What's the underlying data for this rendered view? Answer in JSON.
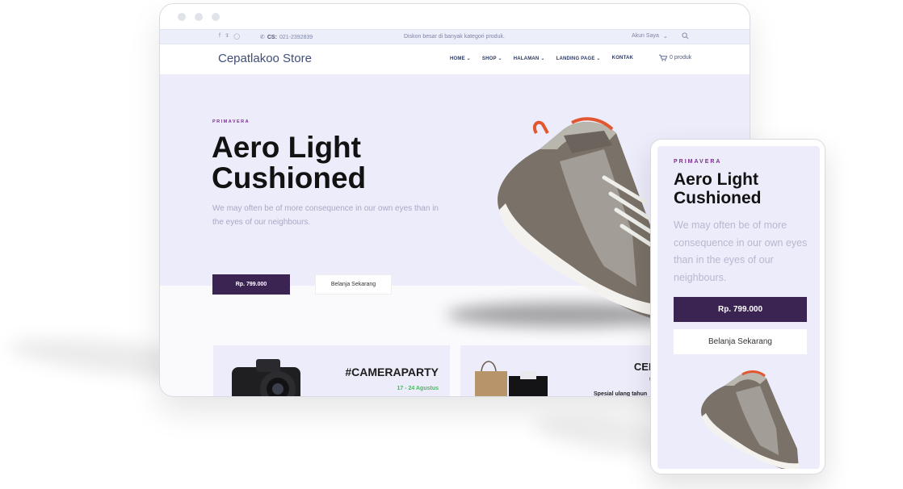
{
  "topbar": {
    "social_icons": [
      "facebook-icon",
      "twitter-icon",
      "instagram-icon"
    ],
    "cs_label": "CS:",
    "cs_phone": "021-2392839",
    "promo_text": "Diskon besar di banyak kategori produk.",
    "account_label": "Akun Saya"
  },
  "nav": {
    "brand": "Cepatlakoo Store",
    "menu": [
      "HOME",
      "SHOP",
      "HALAMAN",
      "LANDING PAGE",
      "KONTAK"
    ],
    "cart_label": "0 produk"
  },
  "hero": {
    "eyebrow": "PRIMAVERA",
    "title": "Aero Light Cushioned",
    "description": "We may often be of more consequence in our own eyes than in the eyes of our neighbours.",
    "price_button": "Rp. 799.000",
    "shop_button": "Belanja Sekarang"
  },
  "promos": [
    {
      "title": "#CAMERAPARTY",
      "subtitle": "17 - 24 Agustus"
    },
    {
      "title": "CEPATL GIVE",
      "subtitle": "Spesial ulang tahun"
    }
  ],
  "mobile": {
    "eyebrow": "PRIMAVERA",
    "title": "Aero Light Cushioned",
    "description": "We may often be of more consequence in our own eyes than in the eyes of our neighbours.",
    "price_button": "Rp. 799.000",
    "shop_button": "Belanja Sekarang"
  },
  "colors": {
    "accent_dark": "#3b2452",
    "hero_bg": "#edecfb",
    "eyebrow": "#7a2e8e",
    "brand": "#3f4f7a",
    "date_green": "#48b95d"
  }
}
